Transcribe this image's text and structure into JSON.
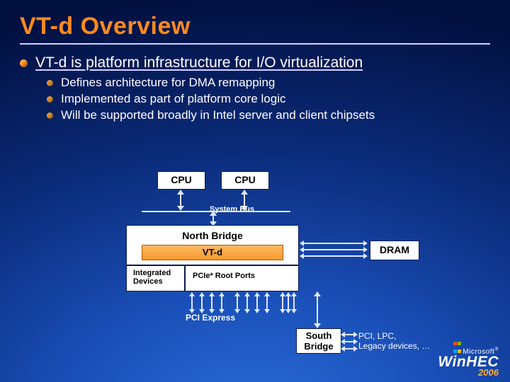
{
  "title": "VT-d Overview",
  "bullet_main": "VT-d is platform infrastructure for I/O virtualization",
  "sub_bullets": [
    "Defines architecture for DMA remapping",
    "Implemented as part of platform core logic",
    "Will be supported broadly in Intel server and client chipsets"
  ],
  "diagram": {
    "cpu": "CPU",
    "system_bus": "System Bus",
    "north_bridge": "North Bridge",
    "vtd": "VT-d",
    "integrated_devices_l1": "Integrated",
    "integrated_devices_l2": "Devices",
    "pcie_root_ports": "PCIe* Root Ports",
    "dram": "DRAM",
    "pci_express": "PCI Express",
    "south_bridge_l1": "South",
    "south_bridge_l2": "Bridge",
    "south_bridge_caption_l1": "PCI, LPC,",
    "south_bridge_caption_l2": "Legacy devices, …"
  },
  "brand": {
    "ms": "Microsoft",
    "name": "WinHEC",
    "year": "2006"
  }
}
